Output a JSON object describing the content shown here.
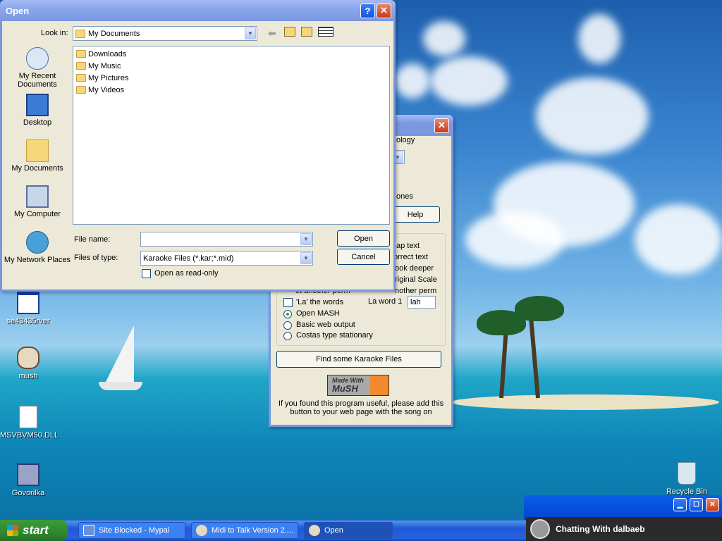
{
  "desktop": {
    "icons": [
      {
        "label": "se43435rver"
      },
      {
        "label": "mush"
      },
      {
        "label": "MSVBVM50.DLL"
      },
      {
        "label": "Govorilka"
      },
      {
        "label": "Recycle Bin"
      }
    ]
  },
  "open_dialog": {
    "title": "Open",
    "look_in_label": "Look in:",
    "look_in_value": "My Documents",
    "places": [
      "My Recent Documents",
      "Desktop",
      "My Documents",
      "My Computer",
      "My Network Places"
    ],
    "files": [
      "Downloads",
      "My Music",
      "My Pictures",
      "My Videos"
    ],
    "file_name_label": "File name:",
    "file_name_value": "",
    "files_of_type_label": "Files of type:",
    "files_of_type_value": "Karaoke Files (*.kar;*.mid)",
    "read_only_label": "Open as read-only",
    "open_button": "Open",
    "cancel_button": "Cancel"
  },
  "midi_window": {
    "title": "Midi to Talk Version 2....",
    "partial_texts": {
      "ology": "ology",
      "ones": "ones",
      "ap_text": "ap text",
      "orrect_text": "orrect text",
      "ook_deeper": "ook deeper",
      "riginal_scale": "riginal Scale",
      "nother_perm": "nother perm",
      "ot_another_perm": "ot another perm"
    },
    "help_button": "Help",
    "la_words_label": "'La' the words",
    "la_word_label": "La word 1",
    "la_word_value": "lah",
    "radios": [
      "Open MASH",
      "Basic web output",
      "Costas type stationary"
    ],
    "find_button": "Find some Karaoke Files",
    "badge_top": "Made With",
    "badge_bottom": "MuSH",
    "footer_text": "If you found this program useful, please add this button to your web page with the song on"
  },
  "chat_popup": {
    "text": "Chatting With dalbaeb"
  },
  "taskbar": {
    "start_label": "start",
    "tasks": [
      {
        "label": "Site Blocked - Mypal"
      },
      {
        "label": "Midi to Talk Version 2...."
      },
      {
        "label": "Open"
      }
    ]
  }
}
